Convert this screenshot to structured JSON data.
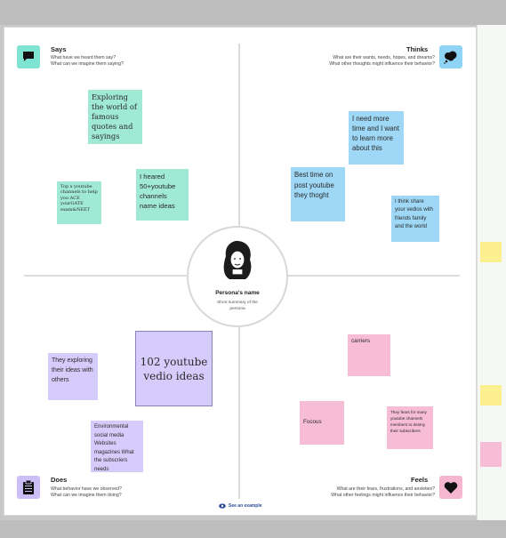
{
  "quadrants": {
    "says": {
      "title": "Says",
      "line1": "What have we heard them say?",
      "line2": "What can we imagine them saying?",
      "color": "#7fe3d3",
      "icon": "speech-bubble-icon"
    },
    "thinks": {
      "title": "Thinks",
      "line1": "What are their wants, needs, hopes, and dreams?",
      "line2": "What other thoughts might influence their behavior?",
      "color": "#8fd4f5",
      "icon": "thought-cloud-icon"
    },
    "does": {
      "title": "Does",
      "line1": "What behavior have we observed?",
      "line2": "What can we imagine them doing?",
      "color": "#cbbdf6",
      "icon": "clipboard-icon"
    },
    "feels": {
      "title": "Feels",
      "line1": "What are their fears, frustrations, and anxieties?",
      "line2": "What other feelings might influence their behavior?",
      "color": "#f7b6d0",
      "icon": "heart-icon"
    }
  },
  "persona": {
    "name": "Persona's name",
    "summary": "Short summary of the persona",
    "avatar_icon": "person-avatar-icon"
  },
  "notes": {
    "says_quotes": "Exploring the world of famous quotes and sayings",
    "says_channels": "Top x youtube channels to help you ACE yourGATE exam&NEET",
    "says_names": "I heared 50+youtube channels name ideas",
    "thinks_time": "I need more time and I want to learn more about this",
    "thinks_best_time": "Best time on post youtube they thoght",
    "thinks_share": "I think share your vedios with friends family and the world",
    "does_ideas": "102 youtube vedio ideas",
    "does_exploring": "They exploring their ideas with others",
    "does_topics": "Environmental social media Websites magazines What the subscriers needs",
    "feels_carriers": "carriers",
    "feels_focous": "Focous",
    "feels_fears": "They fears for many youtube channels members to destoy their subscribers"
  },
  "example_link": "See an example",
  "side_note_colors": [
    "#fcef8f",
    "#fcef8f",
    "#f7bdd6"
  ]
}
